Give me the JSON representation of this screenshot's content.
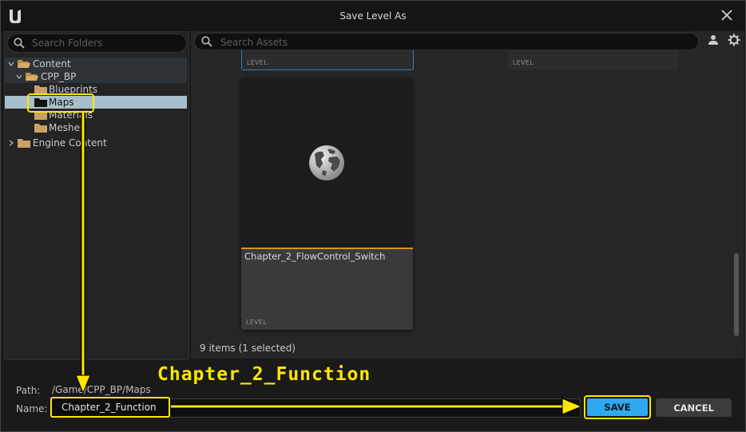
{
  "window": {
    "title": "Save Level As"
  },
  "left_panel": {
    "search_placeholder": "Search Folders",
    "tree": [
      {
        "label": "Content"
      },
      {
        "label": "CPP_BP"
      },
      {
        "label": "Blueprints"
      },
      {
        "label": "Maps"
      },
      {
        "label": "Materials"
      },
      {
        "label": "Meshes"
      },
      {
        "label": "Engine Content"
      }
    ]
  },
  "right_panel": {
    "search_placeholder": "Search Assets",
    "tiles_top": [
      {
        "type": "LEVEL"
      },
      {
        "type": "LEVEL"
      }
    ],
    "selected_tile": {
      "name": "Chapter_2_FlowControl_Switch",
      "type": "LEVEL"
    },
    "items_count": "9 items (1 selected)"
  },
  "bottom": {
    "path_label": "Path:",
    "path_value": "/Game/CPP_BP/Maps",
    "name_label": "Name:",
    "name_value": "Chapter_2_Function",
    "save_label": "SAVE",
    "cancel_label": "CANCEL"
  },
  "annotation": {
    "caption": "Chapter_2_Function"
  },
  "colors": {
    "accent_blue": "#2ea9f0",
    "highlight_yellow": "#ffe600",
    "selection": "#a7bfcc",
    "asset_accent": "#e28e1d"
  }
}
